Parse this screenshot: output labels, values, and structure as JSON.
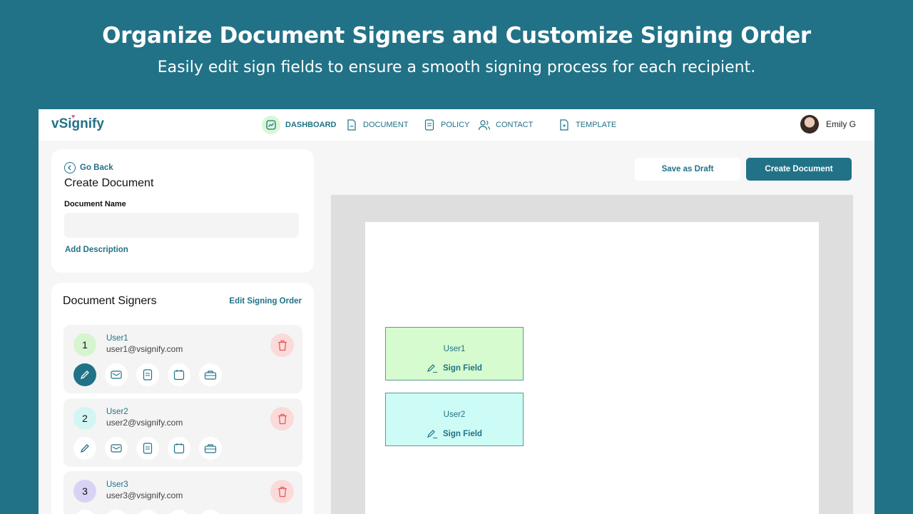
{
  "hero": {
    "title": "Organize Document Signers and Customize Signing Order",
    "subtitle": "Easily edit sign fields to ensure a smooth signing process for each recipient."
  },
  "app": {
    "logo": "vSignify",
    "nav": [
      {
        "label": "DASHBOARD",
        "icon": "dashboard-icon"
      },
      {
        "label": "DOCUMENT",
        "icon": "document-icon"
      },
      {
        "label": "POLICY",
        "icon": "policy-icon"
      },
      {
        "label": "CONTACT",
        "icon": "contact-icon"
      },
      {
        "label": "TEMPLATE",
        "icon": "template-icon"
      }
    ],
    "user_name": "Emily G"
  },
  "create_panel": {
    "go_back": "Go Back",
    "title": "Create Document",
    "doc_name_label": "Document Name",
    "doc_name_value": "",
    "add_description": "Add Description"
  },
  "signers_panel": {
    "title": "Document Signers",
    "edit_order": "Edit Signing Order",
    "signers": [
      {
        "order": "1",
        "name": "User1",
        "email": "user1@vsignify.com",
        "color": "#d6f5cf"
      },
      {
        "order": "2",
        "name": "User2",
        "email": "user2@vsignify.com",
        "color": "#d3f6f4"
      },
      {
        "order": "3",
        "name": "User3",
        "email": "user3@vsignify.com",
        "color": "#d8d3f5"
      }
    ],
    "tools": [
      "signature-icon",
      "mail-icon",
      "text-icon",
      "calendar-icon",
      "stamp-icon"
    ]
  },
  "actions": {
    "save_draft": "Save as Draft",
    "create_document": "Create Document"
  },
  "fields": [
    {
      "name": "User1",
      "type": "Sign Field",
      "color": "#d6fbcf"
    },
    {
      "name": "User2",
      "type": "Sign Field",
      "color": "#ccfcf5"
    }
  ],
  "colors": {
    "brand": "#217287",
    "danger": "#e85a5a"
  }
}
